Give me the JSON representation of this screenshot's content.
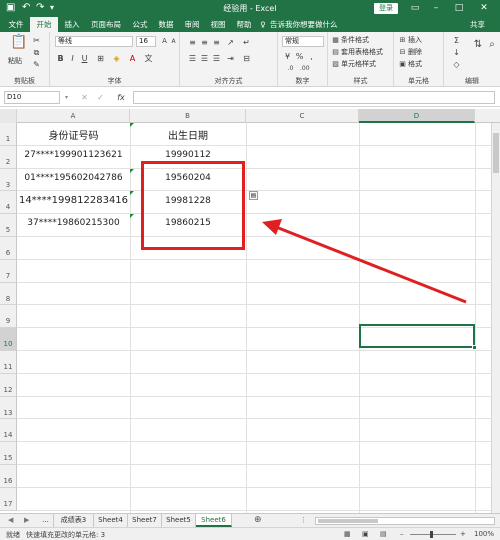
{
  "window": {
    "title": "经验用 - Excel",
    "login_label": "登录"
  },
  "ribbon_tabs": [
    "文件",
    "开始",
    "插入",
    "页面布局",
    "公式",
    "数据",
    "审阅",
    "视图",
    "帮助"
  ],
  "tell_me": "告诉我你想要做什么",
  "share_label": "共享",
  "ribbon": {
    "paste_label": "粘贴",
    "clipboard_label": "剪贴板",
    "font_name": "等线",
    "font_size": "16",
    "font_label": "字体",
    "align_label": "对齐方式",
    "number_format": "常规",
    "number_label": "数字",
    "cond_format": "条件格式",
    "table_format": "套用表格格式",
    "cell_style": "单元格样式",
    "styles_label": "样式",
    "insert": "插入",
    "delete": "删除",
    "format": "格式",
    "cells_label": "单元格",
    "editing_label": "编辑"
  },
  "formula_bar": {
    "name_box": "D10",
    "fx": "fx"
  },
  "grid": {
    "columns": [
      "A",
      "B",
      "C",
      "D"
    ],
    "rows": [
      "1",
      "2",
      "3",
      "4",
      "5",
      "6",
      "7",
      "8",
      "9",
      "10",
      "11",
      "12",
      "13",
      "14",
      "15",
      "16",
      "17"
    ],
    "header_id": "身份证号码",
    "header_birth": "出生日期",
    "ids": [
      "27****199901123621",
      "01****195602042786",
      "14****199812283416",
      "37****19860215300"
    ],
    "births": [
      "19990112",
      "19560204",
      "19981228",
      "19860215"
    ]
  },
  "sheets": [
    "...",
    "成绩表3",
    "Sheet4",
    "Sheet7",
    "Sheet5",
    "Sheet6"
  ],
  "active_sheet": "Sheet6",
  "status": {
    "ready": "就绪",
    "message": "快速填充更改的单元格: 3",
    "zoom": "100%"
  },
  "colors": {
    "excel_green": "#217346",
    "highlight_red": "#e02020"
  }
}
